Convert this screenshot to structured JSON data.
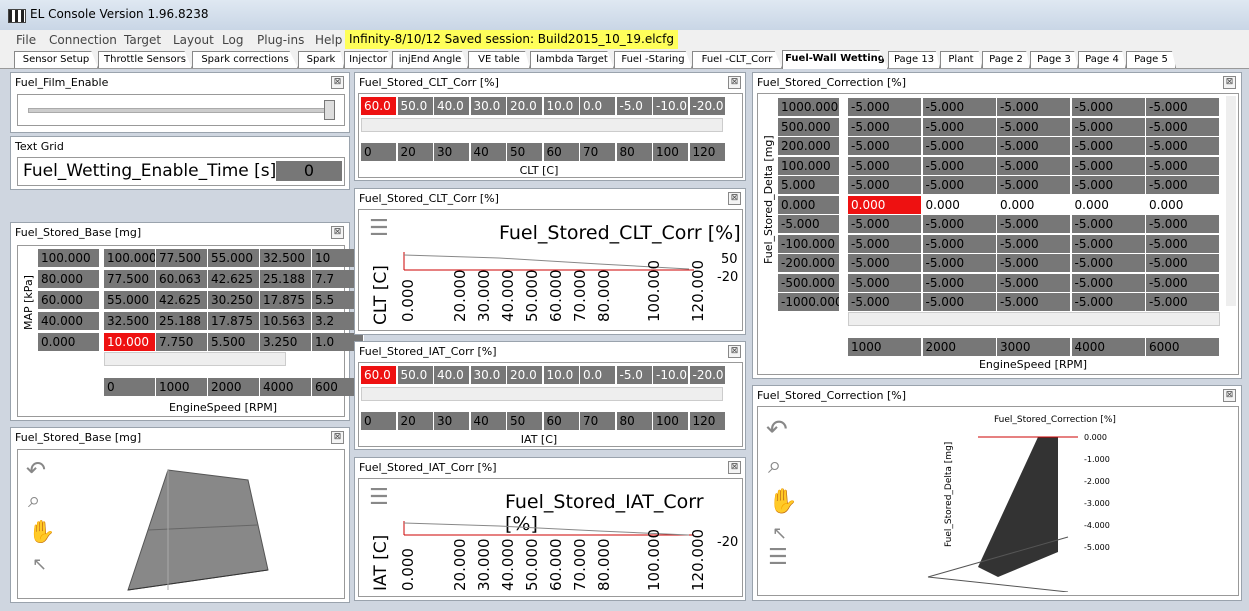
{
  "window": {
    "title": "EL Console Version 1.96.8238"
  },
  "menu": [
    "File",
    "Connection",
    "Target",
    "Layout",
    "Log",
    "Plug-ins",
    "Help"
  ],
  "session": "Infinity-8/10/12 Saved session: Build2015_10_19.elcfg",
  "tabs": [
    "Sensor Setup",
    "Throttle Sensors",
    "Spark corrections",
    "Spark",
    "Injector",
    "injEnd Angle",
    "VE table",
    "lambda Target",
    "Fuel -Staring",
    "Fuel -CLT_Corr",
    "Fuel-Wall Wetting",
    "Page 13",
    "Plant",
    "Page 2",
    "Page 3",
    "Page 4",
    "Page 5"
  ],
  "active_tab": "Fuel-Wall Wetting",
  "panels": {
    "film": {
      "title": "Fuel_Film_Enable",
      "slider_fraction": 1.0
    },
    "textgrid": {
      "title": "Text Grid",
      "label": "Fuel_Wetting_Enable_Time [s]",
      "value": "0"
    },
    "base": {
      "title": "Fuel_Stored_Base [mg]",
      "ylabel": "MAP [kPa]",
      "xlabel": "EngineSpeed [RPM]",
      "rows": [
        "100.000",
        "80.000",
        "60.000",
        "40.000",
        "0.000"
      ],
      "data": [
        [
          "100.000",
          "77.500",
          "55.000",
          "32.500",
          "10"
        ],
        [
          "77.500",
          "60.063",
          "42.625",
          "25.188",
          "7.7"
        ],
        [
          "55.000",
          "42.625",
          "30.250",
          "17.875",
          "5.5"
        ],
        [
          "32.500",
          "25.188",
          "17.875",
          "10.563",
          "3.2"
        ],
        [
          "10.000",
          "7.750",
          "5.500",
          "3.250",
          "1.0"
        ]
      ],
      "cols": [
        "0",
        "1000",
        "2000",
        "4000",
        "600"
      ]
    },
    "base3d": {
      "title": "Fuel_Stored_Base [mg]"
    },
    "clt": {
      "title": "Fuel_Stored_CLT_Corr [%]",
      "values": [
        "60.0",
        "50.0",
        "40.0",
        "30.0",
        "20.0",
        "10.0",
        "0.0",
        "-5.0",
        "-10.0",
        "-20.0"
      ],
      "axis": [
        "0",
        "20",
        "30",
        "40",
        "50",
        "60",
        "70",
        "80",
        "100",
        "120"
      ],
      "xlabel": "CLT [C]"
    },
    "clt_chart": {
      "title": "Fuel_Stored_CLT_Corr [%]",
      "heading": "Fuel_Stored_CLT_Corr [%]",
      "ylabel": "CLT [C]",
      "right_top": "50",
      "right_bot": "-20",
      "ticks": [
        "0.000",
        "20.000",
        "30.000",
        "40.000",
        "50.000",
        "60.000",
        "70.000",
        "80.000",
        "100.000",
        "120.000"
      ]
    },
    "iat": {
      "title": "Fuel_Stored_IAT_Corr [%]",
      "values": [
        "60.0",
        "50.0",
        "40.0",
        "30.0",
        "20.0",
        "10.0",
        "0.0",
        "-5.0",
        "-10.0",
        "-20.0"
      ],
      "axis": [
        "0",
        "20",
        "30",
        "40",
        "50",
        "60",
        "70",
        "80",
        "100",
        "120"
      ],
      "xlabel": "IAT [C]"
    },
    "iat_chart": {
      "title": "Fuel_Stored_IAT_Corr [%]",
      "heading": "Fuel_Stored_IAT_Corr [%]",
      "ylabel": "IAT [C]",
      "right_bot": "-20",
      "ticks": [
        "0.000",
        "20.000",
        "30.000",
        "40.000",
        "50.000",
        "60.000",
        "70.000",
        "80.000",
        "100.000",
        "120.000"
      ]
    },
    "corr": {
      "title": "Fuel_Stored_Correction [%]",
      "ylabel": "Fuel_Stored_Delta [mg]",
      "xlabel": "EngineSpeed [RPM]",
      "rows": [
        "1000.000",
        "500.000",
        "200.000",
        "100.000",
        "5.000",
        "0.000",
        "-5.000",
        "-100.000",
        "-200.000",
        "-500.000",
        "-1000.000"
      ],
      "cols": [
        "1000",
        "2000",
        "3000",
        "4000",
        "6000"
      ]
    },
    "corr3d": {
      "title": "Fuel_Stored_Correction [%]",
      "ztitle": "Fuel_Stored_Correction [%]",
      "zaxis": [
        "0.000",
        "-1.000",
        "-2.000",
        "-3.000",
        "-4.000",
        "-5.000"
      ],
      "ylabel": "Fuel_Stored_Delta [mg]"
    }
  }
}
